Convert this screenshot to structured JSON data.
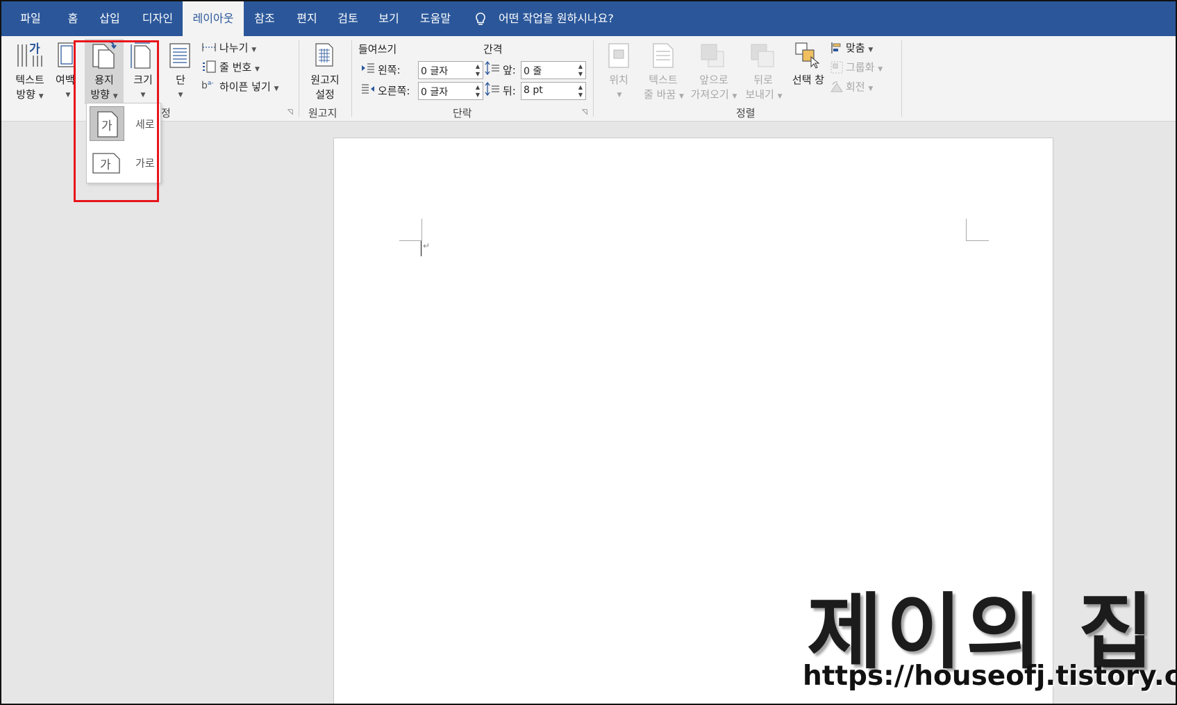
{
  "tabs": [
    {
      "label": "파일"
    },
    {
      "label": "홈"
    },
    {
      "label": "삽입"
    },
    {
      "label": "디자인"
    },
    {
      "label": "레이아웃",
      "active": true
    },
    {
      "label": "참조"
    },
    {
      "label": "편지"
    },
    {
      "label": "검토"
    },
    {
      "label": "보기"
    },
    {
      "label": "도움말"
    }
  ],
  "tell_me": "어떤 작업을 원하시나요?",
  "page_setup": {
    "text_direction": [
      "텍스트",
      "방향"
    ],
    "margins": "여백",
    "orientation": [
      "용지",
      "방향"
    ],
    "size": "크기",
    "columns": "단",
    "breaks": "나누기",
    "line_numbers": "줄 번호",
    "hyphenation": "하이픈 넣기",
    "group_label_tail": "정"
  },
  "manuscript": {
    "button": [
      "원고지",
      "설정"
    ],
    "group_label": "원고지"
  },
  "paragraph": {
    "indent_header": "들여쓰기",
    "spacing_header": "간격",
    "left_label": "왼쪽:",
    "right_label": "오른쪽:",
    "before_label": "앞:",
    "after_label": "뒤:",
    "left_value": "0 글자",
    "right_value": "0 글자",
    "before_value": "0 줄",
    "after_value": "8 pt",
    "group_label": "단락"
  },
  "arrange": {
    "position": "위치",
    "wrap_text": [
      "텍스트",
      "줄 바꿈"
    ],
    "bring_forward": [
      "앞으로",
      "가져오기"
    ],
    "send_backward": [
      "뒤로",
      "보내기"
    ],
    "selection_pane": "선택 창",
    "align": "맞춤",
    "group": "그룹화",
    "rotate": "회전",
    "group_label": "정렬"
  },
  "orientation_menu": {
    "items": [
      {
        "label": "세로",
        "glyph": "가",
        "selected": true
      },
      {
        "label": "가로",
        "glyph": "가",
        "selected": false
      }
    ]
  },
  "document": {
    "paragraph_mark": "↵"
  },
  "watermark": {
    "title": "제이의 집",
    "url": "https://houseofj.tistory.com/"
  },
  "colors": {
    "accent": "#2b579a",
    "highlight": "#e8141c"
  }
}
